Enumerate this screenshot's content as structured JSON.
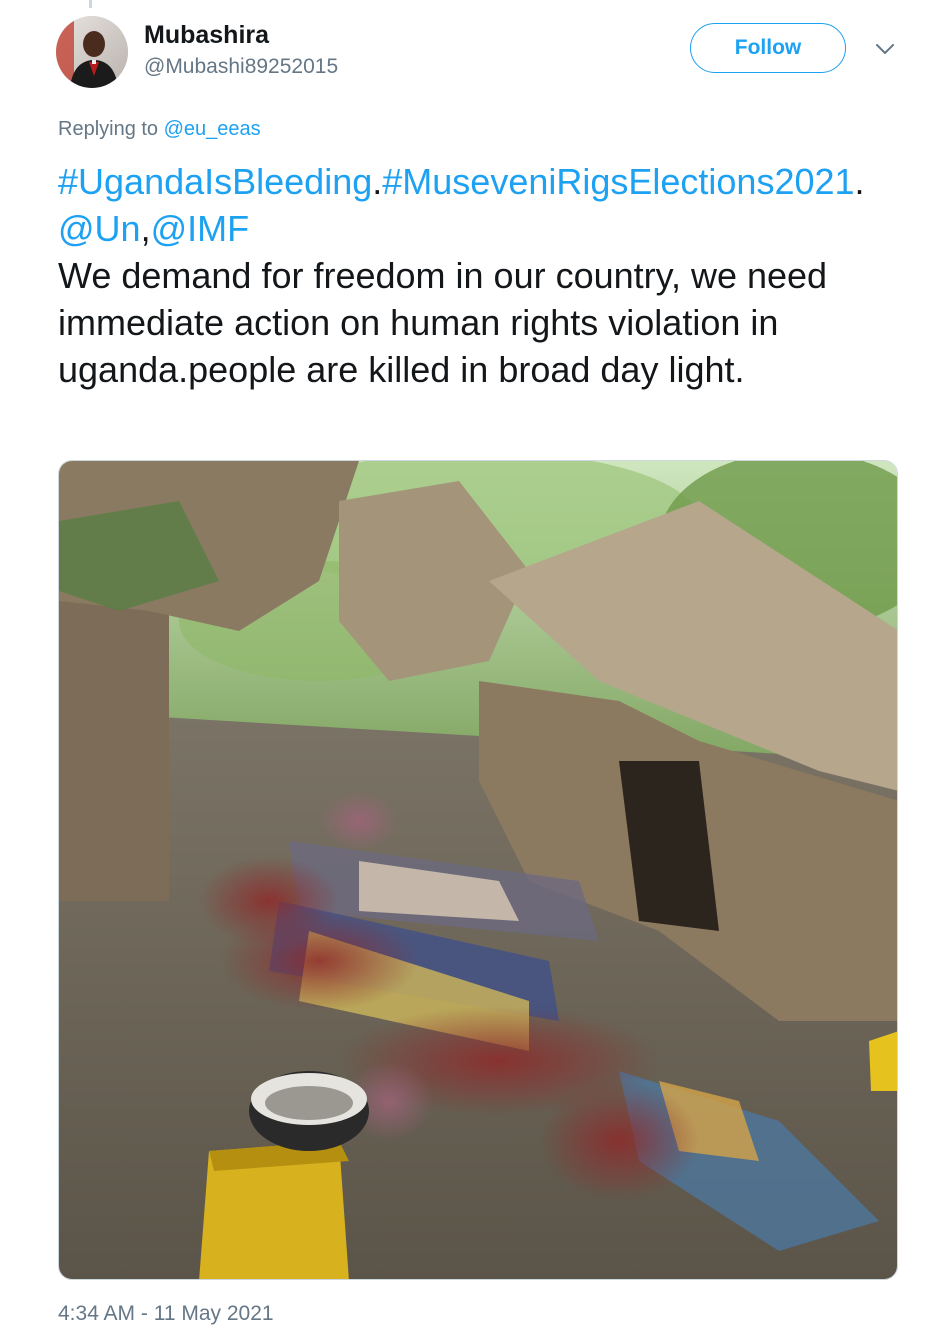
{
  "user": {
    "display_name": "Mubashira",
    "handle": "@Mubashi89252015",
    "avatar_icon": "user-avatar-photo"
  },
  "follow_button": {
    "label": "Follow"
  },
  "menu": {
    "icon": "chevron-down-icon"
  },
  "reply": {
    "prefix": "Replying to ",
    "mention": "@eu_eeas"
  },
  "tweet": {
    "hashtag_1": "#UgandaIsBleeding",
    "sep_1": ".",
    "hashtag_2": "#MuseveniRigsElections2021",
    "sep_2": ".",
    "mention_1": "@Un",
    "sep_3": ",",
    "mention_2": "@IMF",
    "body": "We demand for freedom in our country, we need immediate action on human rights violation in uganda.people are killed in broad day light."
  },
  "media": {
    "kind": "photo",
    "description_icon": "photo-image"
  },
  "timestamp": "4:34 AM - 11 May 2021",
  "colors": {
    "link": "#1da1f2",
    "text": "#14171a",
    "secondary": "#657786",
    "border": "#ccd6dd"
  }
}
